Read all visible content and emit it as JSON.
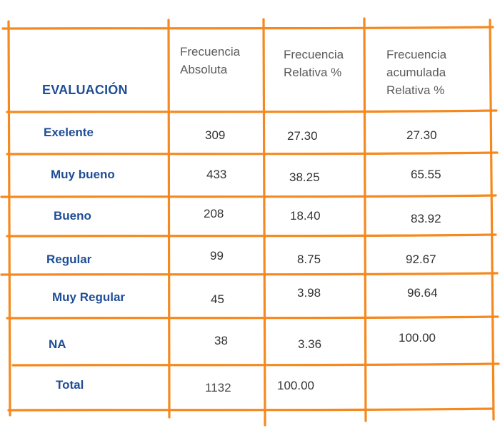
{
  "table": {
    "header": {
      "evaluation": "EVALUACIÓN",
      "abs_line1": "Frecuencia",
      "abs_line2": "Absoluta",
      "rel_line1": "Frecuencia",
      "rel_line2": "Relativa %",
      "acc_line1": "Frecuencia",
      "acc_line2": "acumulada",
      "acc_line3": "Relativa %"
    },
    "rows": [
      {
        "label": "Exelente",
        "absolute": "309",
        "relative": "27.30",
        "cumulative": "27.30"
      },
      {
        "label": "Muy bueno",
        "absolute": "433",
        "relative": "38.25",
        "cumulative": "65.55"
      },
      {
        "label": "Bueno",
        "absolute": "208",
        "relative": "18.40",
        "cumulative": "83.92"
      },
      {
        "label": "Regular",
        "absolute": "99",
        "relative": "8.75",
        "cumulative": "92.67"
      },
      {
        "label": "Muy Regular",
        "absolute": "45",
        "relative": "3.98",
        "cumulative": "96.64"
      },
      {
        "label": "NA",
        "absolute": "38",
        "relative": "3.36",
        "cumulative": "100.00"
      }
    ],
    "total": {
      "label": "Total",
      "absolute": "1132",
      "relative": "100.00",
      "cumulative": ""
    },
    "line_color": "#f5891f"
  }
}
